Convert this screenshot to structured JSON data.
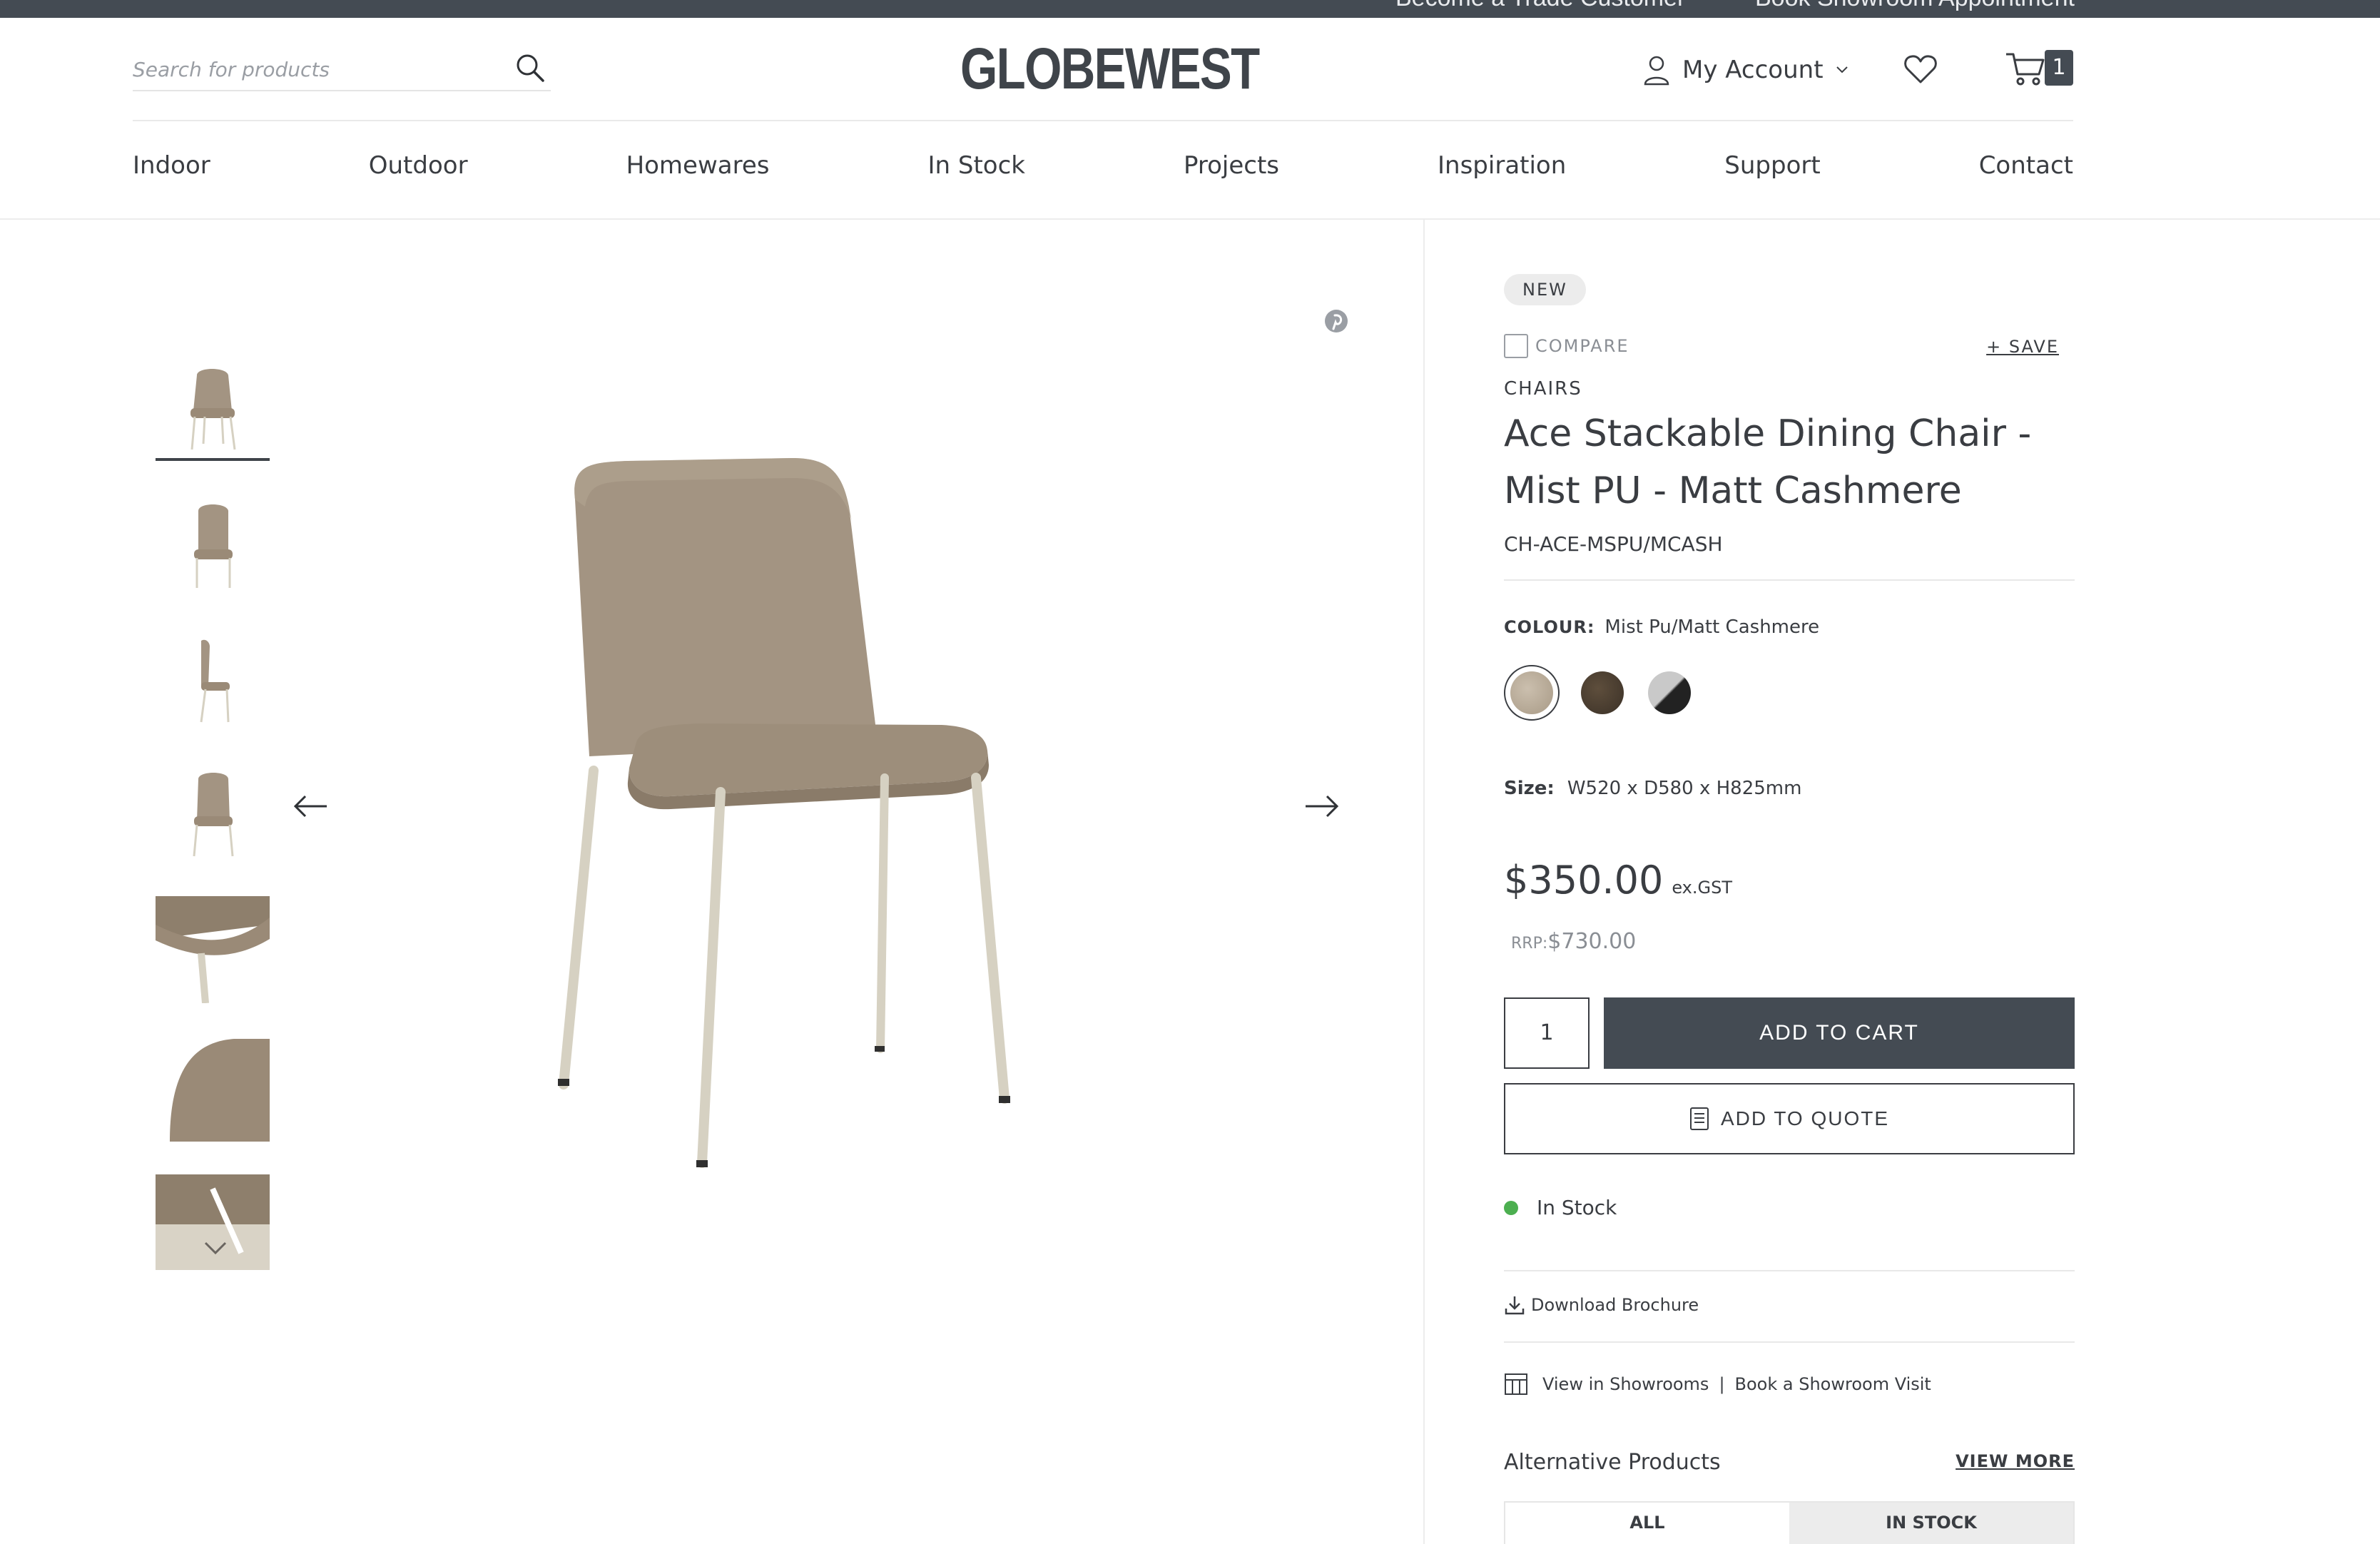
{
  "topbar": {
    "link1": "Become a Trade Customer",
    "link2": "Book Showroom Appointment"
  },
  "header": {
    "search_placeholder": "Search for products",
    "logo": "GLOBEWEST",
    "account_label": "My Account",
    "cart_count": "1"
  },
  "nav": {
    "items": [
      "Indoor",
      "Outdoor",
      "Homewares",
      "In Stock",
      "Projects",
      "Inspiration",
      "Support",
      "Contact"
    ]
  },
  "product": {
    "badge": "NEW",
    "compare_label": "COMPARE",
    "save_label": "+ SAVE",
    "category": "CHAIRS",
    "title": "Ace Stackable Dining Chair - Mist PU - Matt Cashmere",
    "sku": "CH-ACE-MSPU/MCASH",
    "colour_label": "COLOUR:",
    "colour_value": "Mist Pu/Matt Cashmere",
    "swatches": [
      {
        "name": "Mist PU / Matt Cashmere",
        "color": "#b9aa97",
        "selected": true
      },
      {
        "name": "Dark",
        "color": "#4b3f33",
        "selected": false
      },
      {
        "name": "Grey / Black",
        "color": "#8e8e8e",
        "selected": false
      }
    ],
    "size_label": "Size:",
    "size_value": "W520 x D580 x H825mm",
    "price": "$350.00",
    "price_suffix": "ex.GST",
    "rrp_label": "RRP:",
    "rrp_value": "$730.00",
    "quantity": "1",
    "add_to_cart": "ADD TO CART",
    "add_to_quote": "ADD TO QUOTE",
    "stock_status": "In Stock",
    "download_brochure": "Download Brochure",
    "view_in_showrooms": "View in Showrooms",
    "showroom_separator": "|",
    "book_showroom": "Book a Showroom Visit",
    "alternative_title": "Alternative Products",
    "view_more": "VIEW MORE",
    "tab_all": "ALL",
    "tab_in_stock": "IN STOCK"
  },
  "colors": {
    "primary_dark": "#444b53",
    "chair_seat": "#a39482",
    "chair_frame": "#d6d1c2",
    "stock_green": "#4caf50"
  }
}
